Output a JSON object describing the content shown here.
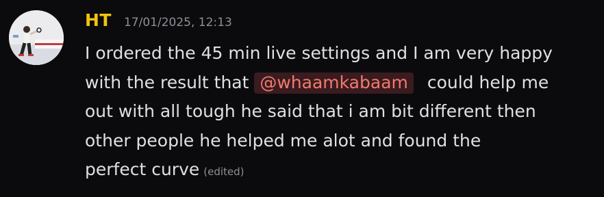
{
  "message": {
    "author": "HT",
    "timestamp": "17/01/2025, 12:13",
    "line1": "I ordered the 45 min live settings and I am very happy",
    "line2_before": "with the result that",
    "mention": "@whaamkabaam",
    "line2_after": "could help me",
    "line3": "out with all tough he said that i am bit different then",
    "line4": "other people he helped me alot and found the",
    "line5": "perfect curve",
    "edited_label": "(edited)"
  },
  "colors": {
    "background": "#0b0b0d",
    "username": "#f1c40f",
    "text": "#dfe0e4",
    "muted": "#8e9098",
    "mention_text": "#f07b6e",
    "mention_bg": "#3a1b1f"
  }
}
